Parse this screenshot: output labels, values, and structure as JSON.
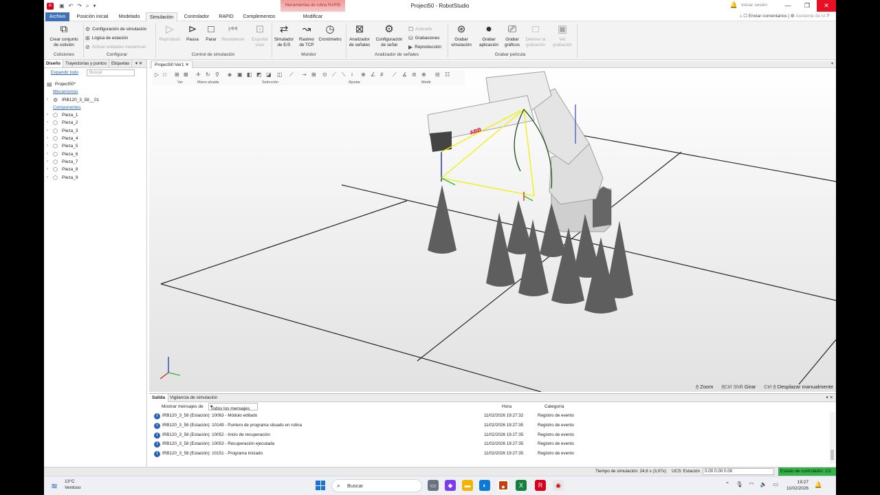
{
  "titlebar": {
    "title": "Project50 - RobotStudio",
    "context_tab": "Herramientas de rutina RAPID",
    "signin": "Iniciar sesión",
    "qa_icons": [
      "save-icon",
      "undo-icon",
      "redo-icon",
      "search-icon",
      "dropdown-icon"
    ]
  },
  "tabs": {
    "file": "Archivo",
    "items": [
      "Posición inicial",
      "Modelado",
      "Simulación",
      "Controlador",
      "RAPID",
      "Complementos"
    ],
    "context": "Modificar",
    "feedback": "Enviar comentarios",
    "ai": "Asistente de IA"
  },
  "ribbon": {
    "colisiones": {
      "create": "Crear conjunto de colisión",
      "group": "Colisiones"
    },
    "configurar": {
      "sim_config": "Configuración de simulación",
      "station_logic": "Lógica de estación",
      "mech_units": "Activar unidades mecánicas",
      "group": "Configurar"
    },
    "control": {
      "play": "Reproducir",
      "pause": "Pausa",
      "stop": "Parar",
      "reset": "Restablecer",
      "export": "Exportar visor",
      "group": "Control de simulación"
    },
    "monitor": {
      "io": "Simulador de E/S",
      "tcp": "Rastreo de TCP",
      "timer": "Cronómetro",
      "group": "Monitor"
    },
    "signals": {
      "analyzer": "Analizador de señales",
      "config": "Configuración de señal",
      "activated": "Activado",
      "recordings": "Grabaciones",
      "playback": "Reproducción",
      "group": "Analizador de señales"
    },
    "recording": {
      "rec_sim": "Grabar simulación",
      "rec_app": "Grabar aplicación",
      "rec_graphics": "Grabar gráficos",
      "stop_rec": "Detener la grabación",
      "view_rec": "Ver grabación",
      "group": "Grabar película"
    }
  },
  "left_panel": {
    "tabs": [
      "Diseño",
      "Trayectorias y puntos",
      "Etiquetas"
    ],
    "expand_all": "Expandir todo",
    "search_placeholder": "Buscar",
    "project": "Project50*",
    "mechanisms_label": "Mecanismos",
    "robot": "IRB120_3_58__01",
    "components_label": "Componentes",
    "parts": [
      "Pieza_1",
      "Pieza_2",
      "Pieza_3",
      "Pieza_4",
      "Pieza_5",
      "Pieza_6",
      "Pieza_7",
      "Pieza_8",
      "Pieza_9"
    ]
  },
  "viewport": {
    "tab": "Project50:Ver1",
    "toolbar_groups": [
      "Ver",
      "Mano alzada",
      "Selección",
      "Ajustar",
      "Medir"
    ],
    "robot_brand": "ABB",
    "status": {
      "zoom": "Zoom",
      "rotate": "Girar",
      "pan": "Desplazar manualmente"
    },
    "keys": {
      "shift": "Shift",
      "ctrl": "Ctrl"
    }
  },
  "output": {
    "tabs": [
      "Salida",
      "Vigilancia de simulación"
    ],
    "show_label": "Mostrar mensajes de",
    "filter": "Todos los mensajes",
    "col_time": "Hora",
    "col_category": "Categoría",
    "rows": [
      {
        "msg": "IRB120_3_58 (Estación): 10063 - Módulo editado",
        "time": "11/02/2026 19:27:32",
        "cat": "Registro de evento"
      },
      {
        "msg": "IRB120_3_58 (Estación): 10149 - Puntero de programa situado en rutina",
        "time": "11/02/2026 19:27:35",
        "cat": "Registro de evento"
      },
      {
        "msg": "IRB120_3_58 (Estación): 10052 - Inicio de recuperación",
        "time": "11/02/2026 19:27:35",
        "cat": "Registro de evento"
      },
      {
        "msg": "IRB120_3_58 (Estación): 10053 - Recuperación ejecutada",
        "time": "11/02/2026 19:27:35",
        "cat": "Registro de evento"
      },
      {
        "msg": "IRB120_3_58 (Estación): 10151 - Programa iniciado",
        "time": "11/02/2026 19:27:35",
        "cat": "Registro de evento"
      }
    ]
  },
  "statusbar": {
    "sim_time": "Tiempo de simulación: 24,6 s (3,07x)",
    "ucs": "UCS: Estación",
    "coords": "0.00  0.00  0.00",
    "controller": "Estado de controlador: 1/1"
  },
  "taskbar": {
    "temp": "13°C",
    "weather": "Ventoso",
    "search": "Buscar",
    "time": "19:27",
    "date": "11/02/2026"
  },
  "colors": {
    "accent": "#3f6fb5",
    "controller_ok": "#35b34a",
    "close": "#e81123",
    "trajectory": "#f0f000"
  }
}
